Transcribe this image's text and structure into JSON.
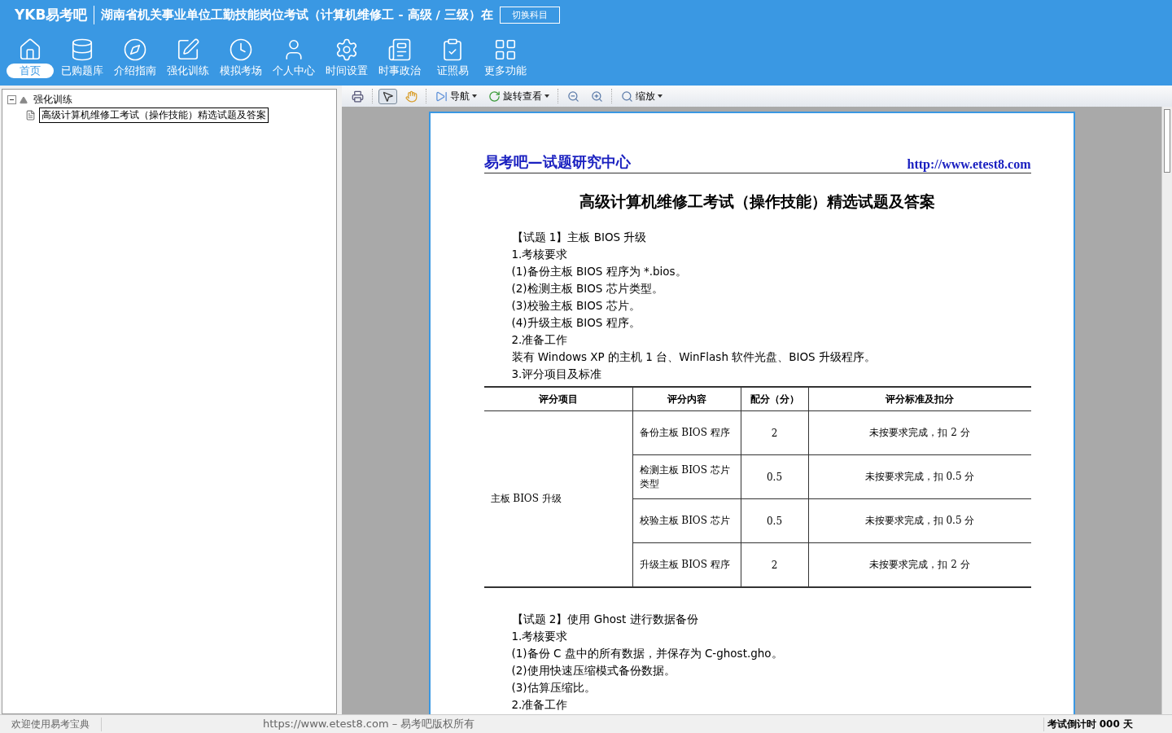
{
  "header": {
    "logo": "YKB易考吧",
    "title": "湖南省机关事业单位工勤技能岗位考试（计算机维修工 - 高级 / 三级）在",
    "switch_button": "切换科目"
  },
  "nav": [
    {
      "label": "首页",
      "selected": true
    },
    {
      "label": "已购题库",
      "selected": false
    },
    {
      "label": "介绍指南",
      "selected": false
    },
    {
      "label": "强化训练",
      "selected": false
    },
    {
      "label": "模拟考场",
      "selected": false
    },
    {
      "label": "个人中心",
      "selected": false
    },
    {
      "label": "时间设置",
      "selected": false
    },
    {
      "label": "时事政治",
      "selected": false
    },
    {
      "label": "证照易",
      "selected": false
    },
    {
      "label": "更多功能",
      "selected": false
    }
  ],
  "tree": [
    {
      "label": "强化训练",
      "expanded": true,
      "children": [
        {
          "label": "高级计算机维修工考试（操作技能）精选试题及答案",
          "selected": true
        }
      ]
    }
  ],
  "toolbar": [
    {
      "kind": "icon"
    },
    {
      "kind": "sep"
    },
    {
      "kind": "icon",
      "selected": true
    },
    {
      "kind": "icon",
      "selected": false
    },
    {
      "kind": "sep"
    },
    {
      "kind": "menu",
      "label": "导航"
    },
    {
      "kind": "menu",
      "label": "旋转查看"
    },
    {
      "kind": "sep"
    },
    {
      "kind": "icon"
    },
    {
      "kind": "icon"
    },
    {
      "kind": "sep"
    },
    {
      "kind": "menu",
      "label": "缩放"
    }
  ],
  "document": {
    "brand": "易考吧—试题研究中心",
    "url": "http://www.etest8.com",
    "title": "高级计算机维修工考试（操作技能）精选试题及答案",
    "section1": [
      "【试题 1】主板 BIOS 升级",
      "1.考核要求",
      "(1)备份主板 BIOS 程序为 *.bios。",
      "(2)检测主板 BIOS 芯片类型。",
      "(3)校验主板 BIOS 芯片。",
      "(4)升级主板 BIOS 程序。",
      "2.准备工作",
      "装有 Windows XP 的主机 1 台、WinFlash 软件光盘、BIOS 升级程序。",
      "3.评分项目及标准"
    ],
    "table": {
      "columns": [
        "评分项目",
        "评分内容",
        "配分（分）",
        "评分标准及扣分"
      ],
      "group": "主板 BIOS 升级",
      "rows": [
        {
          "content": "备份主板 BIOS 程序",
          "score": "2",
          "rule": "未按要求完成，扣 2 分"
        },
        {
          "content": "检测主板 BIOS 芯片类型",
          "score": "0.5",
          "rule": "未按要求完成，扣 0.5 分"
        },
        {
          "content": "校验主板 BIOS 芯片",
          "score": "0.5",
          "rule": "未按要求完成，扣 0.5 分"
        },
        {
          "content": "升级主板 BIOS 程序",
          "score": "2",
          "rule": "未按要求完成，扣 2 分"
        }
      ]
    },
    "section2": [
      "【试题 2】使用 Ghost 进行数据备份",
      "1.考核要求",
      "(1)备份 C 盘中的所有数据，并保存为 C-ghost.gho。",
      "(2)使用快速压缩模式备份数据。",
      "(3)估算压缩比。",
      "2.准备工作"
    ]
  },
  "status_bar": {
    "welcome": "欢迎使用易考宝典",
    "copyright": "https://www.etest8.com – 易考吧版权所有",
    "countdown": "考试倒计时 000 天"
  }
}
